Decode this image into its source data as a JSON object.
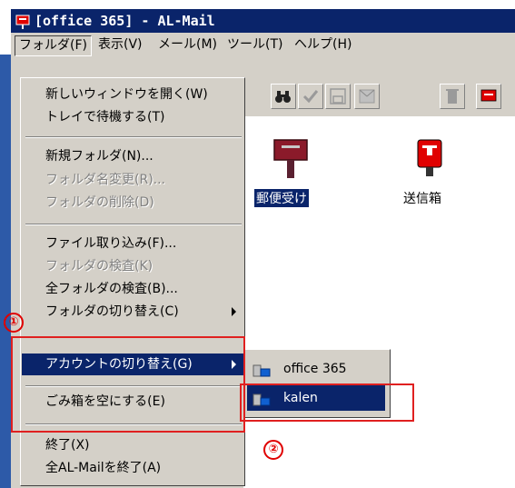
{
  "window": {
    "title": "[office 365] - AL-Mail"
  },
  "menubar": {
    "items": [
      "フォルダ(F)",
      "表示(V)",
      "メール(M)",
      "ツール(T)",
      "ヘルプ(H)"
    ]
  },
  "folder_menu": {
    "items": [
      {
        "label": "新しいウィンドウを開く(W)",
        "disabled": false
      },
      {
        "label": "トレイで待機する(T)",
        "disabled": false
      },
      {
        "label": "新規フォルダ(N)...",
        "disabled": false
      },
      {
        "label": "フォルダ名変更(R)...",
        "disabled": true
      },
      {
        "label": "フォルダの削除(D)",
        "disabled": true
      },
      {
        "label": "ファイル取り込み(F)...",
        "disabled": false
      },
      {
        "label": "フォルダの検査(K)",
        "disabled": true
      },
      {
        "label": "全フォルダの検査(B)...",
        "disabled": false
      },
      {
        "label": "フォルダの切り替え(C)",
        "disabled": false
      },
      {
        "label": "アカウントの切り替え(G)",
        "disabled": false
      },
      {
        "label": "ごみ箱を空にする(E)",
        "disabled": false
      },
      {
        "label": "終了(X)",
        "disabled": false
      },
      {
        "label": "全AL-Mailを終了(A)",
        "disabled": false
      }
    ]
  },
  "account_submenu": {
    "items": [
      "office 365",
      "kalen"
    ]
  },
  "folders": {
    "inbox": "郵便受け",
    "outbox": "送信箱"
  },
  "annotations": {
    "step1": "①",
    "step2": "②"
  },
  "colors": {
    "highlight": "#0a246a",
    "annotation": "#e02020",
    "face": "#d4d0c8"
  }
}
